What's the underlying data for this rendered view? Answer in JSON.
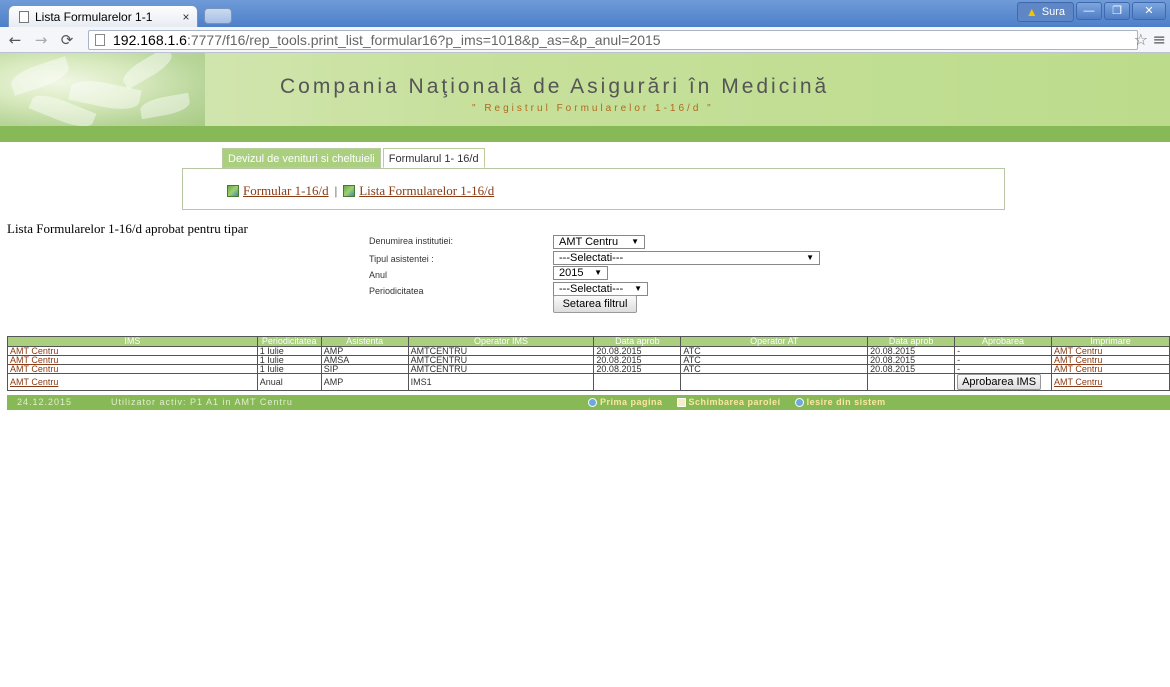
{
  "browser": {
    "tab_title": "Lista Formularelor 1-1",
    "tab_close": "×",
    "user_badge": "Sura",
    "url_host": "192.168.1.6",
    "url_path": ":7777/f16/rep_tools.print_list_formular16?p_ims=1018&p_as=&p_anul=2015"
  },
  "header": {
    "org_name": "Compania Naţională de Asigurări în Medicină",
    "subtitle": "\" Registrul Formularelor 1-16/d \""
  },
  "tabs": [
    {
      "label": "Devizul de venituri si cheltuieli",
      "active": false
    },
    {
      "label": "Formularul 1- 16/d",
      "active": true
    }
  ],
  "panel_links": {
    "link1": "Formular 1-16/d",
    "separator": "|",
    "link2": "Lista Formularelor 1-16/d"
  },
  "section_title": "Lista Formularelor 1-16/d aprobat pentru tipar",
  "filters": {
    "institution_label": "Denumirea institutiei:",
    "institution_value": "AMT Centru",
    "assistance_label": "Tipul asistentei :",
    "assistance_value": "---Selectati---",
    "year_label": "Anul",
    "year_value": "2015",
    "periodicity_label": "Periodicitatea",
    "periodicity_value": "---Selectati---",
    "apply_button": "Setarea filtrul"
  },
  "table": {
    "headers": [
      "IMS",
      "Periodicitatea",
      "Asistenta",
      "Operator IMS",
      "Data aprob",
      "Operator AT",
      "Data aprob",
      "Aprobarea",
      "Imprimare"
    ],
    "rows": [
      [
        "AMT Centru",
        "1 Iulie",
        "AMP",
        "AMTCENTRU",
        "20.08.2015",
        "ATC",
        "20.08.2015",
        "-",
        "AMT Centru"
      ],
      [
        "AMT Centru",
        "1 Iulie",
        "AMSA",
        "AMTCENTRU",
        "20.08.2015",
        "ATC",
        "20.08.2015",
        "-",
        "AMT Centru"
      ],
      [
        "AMT Centru",
        "1 Iulie",
        "SIP",
        "AMTCENTRU",
        "20.08.2015",
        "ATC",
        "20.08.2015",
        "-",
        "AMT Centru"
      ],
      [
        "AMT Centru",
        "Anual",
        "AMP",
        "IMS1",
        "",
        "",
        "",
        "Aprobarea IMS",
        "AMT Centru"
      ]
    ]
  },
  "statusbar": {
    "date": "24.12.2015",
    "user": "Utilizator activ: P1 A1 in AMT Centru",
    "home": "Prima pagina",
    "change_password": "Schimbarea parolei",
    "logout": "Iesire din sistem"
  },
  "colors": {
    "accent_green": "#88b957",
    "header_green": "#a9cf7f",
    "link_brown": "#8a3b14"
  }
}
